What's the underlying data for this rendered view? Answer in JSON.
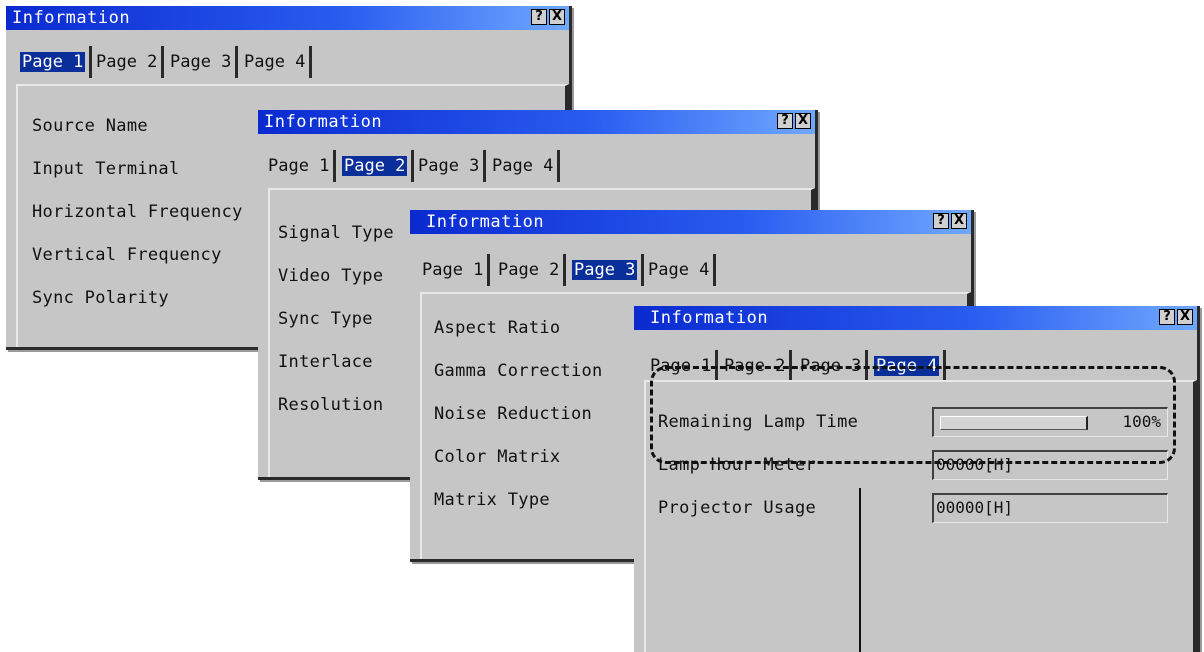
{
  "windows": [
    {
      "title": "Information",
      "help_label": "?",
      "close_label": "X",
      "tabs": [
        "Page 1",
        "Page 2",
        "Page 3",
        "Page 4"
      ],
      "active_tab": 0,
      "rows": [
        "Source Name",
        "Input Terminal",
        "Horizontal Frequency",
        "Vertical Frequency",
        "Sync Polarity"
      ]
    },
    {
      "title": "Information",
      "help_label": "?",
      "close_label": "X",
      "tabs": [
        "Page 1",
        "Page 2",
        "Page 3",
        "Page 4"
      ],
      "active_tab": 1,
      "rows": [
        "Signal Type",
        "Video Type",
        "Sync Type",
        "Interlace",
        "Resolution"
      ]
    },
    {
      "title": "Information",
      "help_label": "?",
      "close_label": "X",
      "tabs": [
        "Page 1",
        "Page 2",
        "Page 3",
        "Page 4"
      ],
      "active_tab": 2,
      "rows": [
        "Aspect Ratio",
        "Gamma Correction",
        "Noise Reduction",
        "Color Matrix",
        "Matrix Type"
      ]
    },
    {
      "title": "Information",
      "help_label": "?",
      "close_label": "X",
      "tabs": [
        "Page 1",
        "Page 2",
        "Page 3",
        "Page 4"
      ],
      "active_tab": 3,
      "rows": [
        "Remaining Lamp Time",
        "Lamp Hour Meter",
        "Projector Usage"
      ],
      "remaining_lamp_percent_label": "100%",
      "remaining_lamp_fraction": 1.0,
      "lamp_hour_meter_value": "00000[H]",
      "projector_usage_value": "00000[H]"
    }
  ],
  "colors": {
    "titlebar": "#0a2ad0",
    "active_tab": "#0a2e9a",
    "window_bg": "#c6c6c6"
  }
}
